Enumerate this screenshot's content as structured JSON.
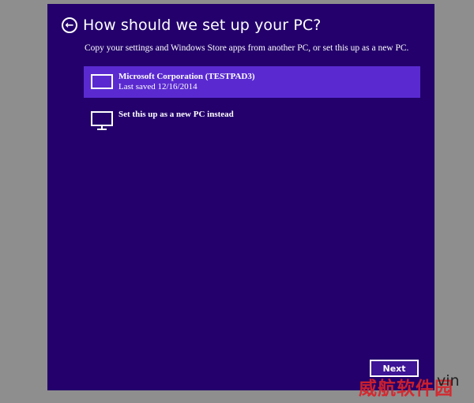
{
  "header": {
    "title": "How should we set up your PC?",
    "back_glyph": "←"
  },
  "subtitle": "Copy your settings and Windows Store apps from another PC, or set this up as a new PC.",
  "options": [
    {
      "name": "Microsoft Corporation (TESTPAD3)",
      "detail": "Last saved 12/16/2014",
      "icon": "tablet-icon",
      "selected": true
    },
    {
      "name": "Set this up as a new PC instead",
      "icon": "monitor-icon",
      "selected": false
    }
  ],
  "footer": {
    "next_label": "Next"
  },
  "watermark": {
    "text": "威航软件园",
    "suffix": "vin"
  },
  "colors": {
    "background": "#23006b",
    "selected": "#5a2ad0",
    "outer": "#8e8e8e",
    "text": "#ffffff"
  }
}
